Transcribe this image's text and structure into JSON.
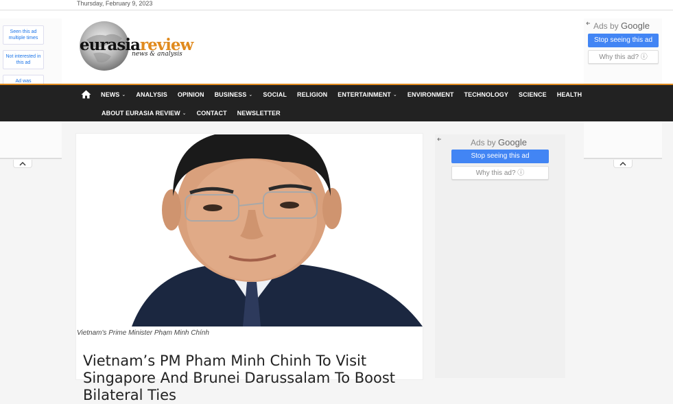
{
  "topbar": {
    "date": "Thursday, February 9, 2023"
  },
  "logo": {
    "primary": "eurasia",
    "accent": "review",
    "tagline": "news & analysis"
  },
  "nav": {
    "row1": [
      {
        "label": "NEWS",
        "dropdown": true
      },
      {
        "label": "ANALYSIS",
        "dropdown": false
      },
      {
        "label": "OPINION",
        "dropdown": false
      },
      {
        "label": "BUSINESS",
        "dropdown": true
      },
      {
        "label": "SOCIAL",
        "dropdown": false
      },
      {
        "label": "RELIGION",
        "dropdown": false
      },
      {
        "label": "ENTERTAINMENT",
        "dropdown": true
      },
      {
        "label": "ENVIRONMENT",
        "dropdown": false
      },
      {
        "label": "TECHNOLOGY",
        "dropdown": false
      },
      {
        "label": "SCIENCE",
        "dropdown": false
      },
      {
        "label": "HEALTH",
        "dropdown": false
      }
    ],
    "row2": [
      {
        "label": "ABOUT EURASIA REVIEW",
        "dropdown": true
      },
      {
        "label": "CONTACT",
        "dropdown": false
      },
      {
        "label": "NEWSLETTER",
        "dropdown": false
      }
    ]
  },
  "left_ad": {
    "seen_multiple": "Seen this ad multiple times",
    "not_interested": "Not interested in this ad",
    "ad_was": "Ad was"
  },
  "right_ad": {
    "ads_by": "Ads by",
    "google": "Google",
    "stop": "Stop seeing this ad",
    "why": "Why this ad? ⓘ"
  },
  "sidebar_ad": {
    "ads_by": "Ads by",
    "google": "Google",
    "stop": "Stop seeing this ad",
    "why": "Why this ad? ⓘ"
  },
  "article": {
    "caption": "Vietnam's Prime Minister Phạm Minh Chính",
    "headline": "Vietnam’s PM Pham Minh Chinh To Visit Singapore And Brunei Darussalam To Boost Bilateral Ties"
  },
  "colors": {
    "nav_bg": "#222222",
    "nav_accent": "#e08a1e",
    "ad_blue": "#4285f4"
  }
}
